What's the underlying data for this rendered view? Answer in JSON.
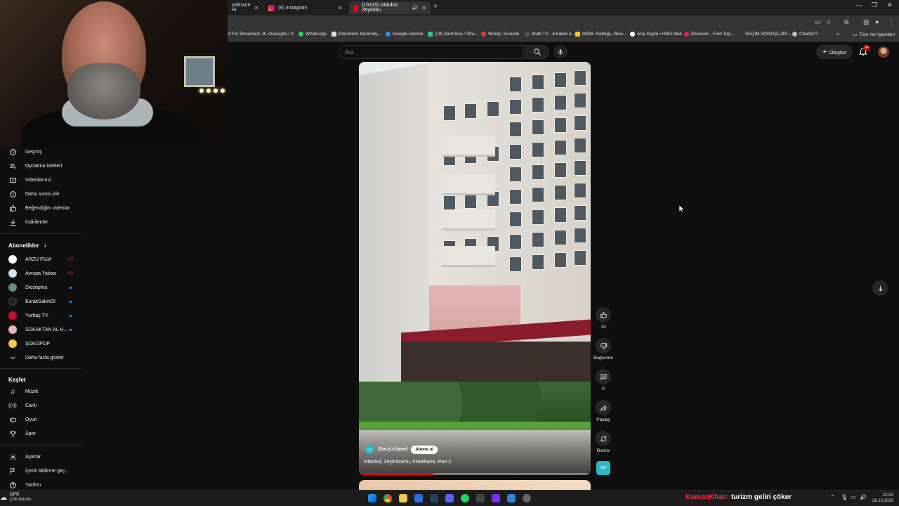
{
  "browser": {
    "tabs": [
      {
        "title": "şekhane Hi",
        "active": false
      },
      {
        "title": "(9) Instagram",
        "active": false
      },
      {
        "title": "(16315) Istanbul, Zeytinbu",
        "active": true
      }
    ],
    "bookmarks": [
      "d For Streamers",
      "Anasayfa / X",
      "WhatsApp",
      "Electronic Diversity...",
      "Google Gemini",
      "(19) Alert Box / Stre...",
      "Windy: Sıcaklık",
      "Multi TV - 6 haber k...",
      "IMDb: Ratings, Revi...",
      "Ana Sayfa • HBO Max",
      "Discover - Find Top...",
      "SEÇİM SONUÇLARI...",
      "ChatGPT",
      "Tüm Yer İşaretleri"
    ]
  },
  "header": {
    "search_placeholder": "Ara",
    "create_label": "Oluştur",
    "notification_count": "9+"
  },
  "sidebar": {
    "you_items": [
      {
        "label": "Geçmiş",
        "icon": "history-icon"
      },
      {
        "label": "Oynatma listeleri",
        "icon": "playlist-icon"
      },
      {
        "label": "Videolarınız",
        "icon": "your-videos-icon"
      },
      {
        "label": "Daha sonra izle",
        "icon": "watch-later-icon"
      },
      {
        "label": "Beğendiğim videolar",
        "icon": "liked-icon"
      },
      {
        "label": "İndirilenler",
        "icon": "download-icon"
      }
    ],
    "subscriptions_title": "Abonelikler",
    "subscriptions": [
      {
        "label": "ARZU FİLM",
        "marker": "live",
        "color": "#ffffff"
      },
      {
        "label": "Avrupa Yakası",
        "marker": "live",
        "color": "#cfe3f0"
      },
      {
        "label": "Diosophia",
        "marker": "dot",
        "color": "#6a8a7a"
      },
      {
        "label": "BurakSakinOl",
        "marker": "dot",
        "color": "#222222"
      },
      {
        "label": "Yurttaş TV",
        "marker": "dot",
        "color": "#c8102e"
      },
      {
        "label": "SOKAKTAN AL H...",
        "marker": "dot",
        "color": "#e7b3b8"
      },
      {
        "label": "ŞOKOPOP",
        "marker": "none",
        "color": "#f2c94c"
      }
    ],
    "show_more_label": "Daha fazla göster",
    "explore_title": "Keşfet",
    "explore_items": [
      {
        "label": "Müzik",
        "icon": "music-icon"
      },
      {
        "label": "Canlı",
        "icon": "live-icon"
      },
      {
        "label": "Oyun",
        "icon": "gaming-icon"
      },
      {
        "label": "Spor",
        "icon": "trophy-icon"
      }
    ],
    "bottom_items": [
      {
        "label": "Ayarlar",
        "icon": "gear-icon"
      },
      {
        "label": "İçerik bildirme geç...",
        "icon": "flag-icon"
      },
      {
        "label": "Yardım",
        "icon": "help-icon"
      }
    ]
  },
  "short": {
    "channel": "@w.d.chanel",
    "subscribe_label": "Abone ol",
    "title": "Istanbul, Zeytinburnu, Fisekhane, Part 2",
    "progress": 0.32
  },
  "actions": {
    "like_count": "13",
    "dislike_label": "Beğenme",
    "comment_count": "0",
    "share_label": "Paylaş",
    "remix_label": "Remix"
  },
  "taskbar": {
    "temperature": "13°C",
    "weather": "Çok bulutlu",
    "ticker_name": "KumanKhan:",
    "ticker_text": "turizm geliri çöker",
    "time": "22:52",
    "date": "28.10.2025"
  }
}
